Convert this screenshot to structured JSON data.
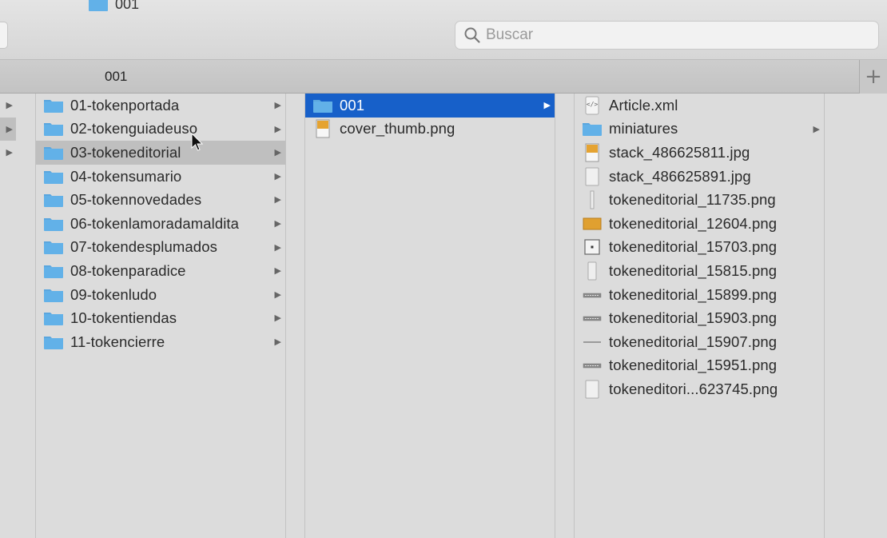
{
  "window": {
    "title": "001"
  },
  "search": {
    "placeholder": "Buscar"
  },
  "tabbar": {
    "tab_label": "001",
    "add_label": "+"
  },
  "colors": {
    "selection": "#1760c9",
    "folder": "#62b1e8",
    "hover": "#bfbfbf"
  },
  "column0": {
    "rows": [
      {
        "arrow": "▶"
      },
      {
        "arrow": "▶"
      },
      {
        "arrow": "▶"
      }
    ]
  },
  "column1": {
    "items": [
      {
        "label": "01-tokenportada",
        "icon": "folder-icon",
        "arrow": "▶"
      },
      {
        "label": "02-tokenguiadeuso",
        "icon": "folder-icon",
        "arrow": "▶"
      },
      {
        "label": "03-tokeneditorial",
        "icon": "folder-icon",
        "arrow": "▶"
      },
      {
        "label": "04-tokensumario",
        "icon": "folder-icon",
        "arrow": "▶"
      },
      {
        "label": "05-tokennovedades",
        "icon": "folder-icon",
        "arrow": "▶"
      },
      {
        "label": "06-tokenlamoradamaldita",
        "icon": "folder-icon",
        "arrow": "▶"
      },
      {
        "label": "07-tokendesplumados",
        "icon": "folder-icon",
        "arrow": "▶"
      },
      {
        "label": "08-tokenparadice",
        "icon": "folder-icon",
        "arrow": "▶"
      },
      {
        "label": "09-tokenludo",
        "icon": "folder-icon",
        "arrow": "▶"
      },
      {
        "label": "10-tokentiendas",
        "icon": "folder-icon",
        "arrow": "▶"
      },
      {
        "label": "11-tokencierre",
        "icon": "folder-icon",
        "arrow": "▶"
      }
    ]
  },
  "column2": {
    "items": [
      {
        "label": "001",
        "icon": "folder-icon",
        "arrow": "▶"
      },
      {
        "label": "cover_thumb.png",
        "icon": "image-file-icon"
      }
    ]
  },
  "column3": {
    "items": [
      {
        "label": "Article.xml",
        "icon": "xml-file-icon"
      },
      {
        "label": "miniatures",
        "icon": "folder-icon",
        "arrow": "▶"
      },
      {
        "label": "stack_486625811.jpg",
        "icon": "image-file-icon"
      },
      {
        "label": "stack_486625891.jpg",
        "icon": "blank-file-icon"
      },
      {
        "label": "tokeneditorial_11735.png",
        "icon": "thin-image-icon"
      },
      {
        "label": "tokeneditorial_12604.png",
        "icon": "wide-image-icon"
      },
      {
        "label": "tokeneditorial_15703.png",
        "icon": "dot-image-icon"
      },
      {
        "label": "tokeneditorial_15815.png",
        "icon": "tall-image-icon"
      },
      {
        "label": "tokeneditorial_15899.png",
        "icon": "strip-image-icon"
      },
      {
        "label": "tokeneditorial_15903.png",
        "icon": "strip-image-icon"
      },
      {
        "label": "tokeneditorial_15907.png",
        "icon": "line-image-icon"
      },
      {
        "label": "tokeneditorial_15951.png",
        "icon": "strip-image-icon"
      },
      {
        "label": "tokeneditori...623745.png",
        "icon": "blank-file-icon"
      }
    ]
  }
}
